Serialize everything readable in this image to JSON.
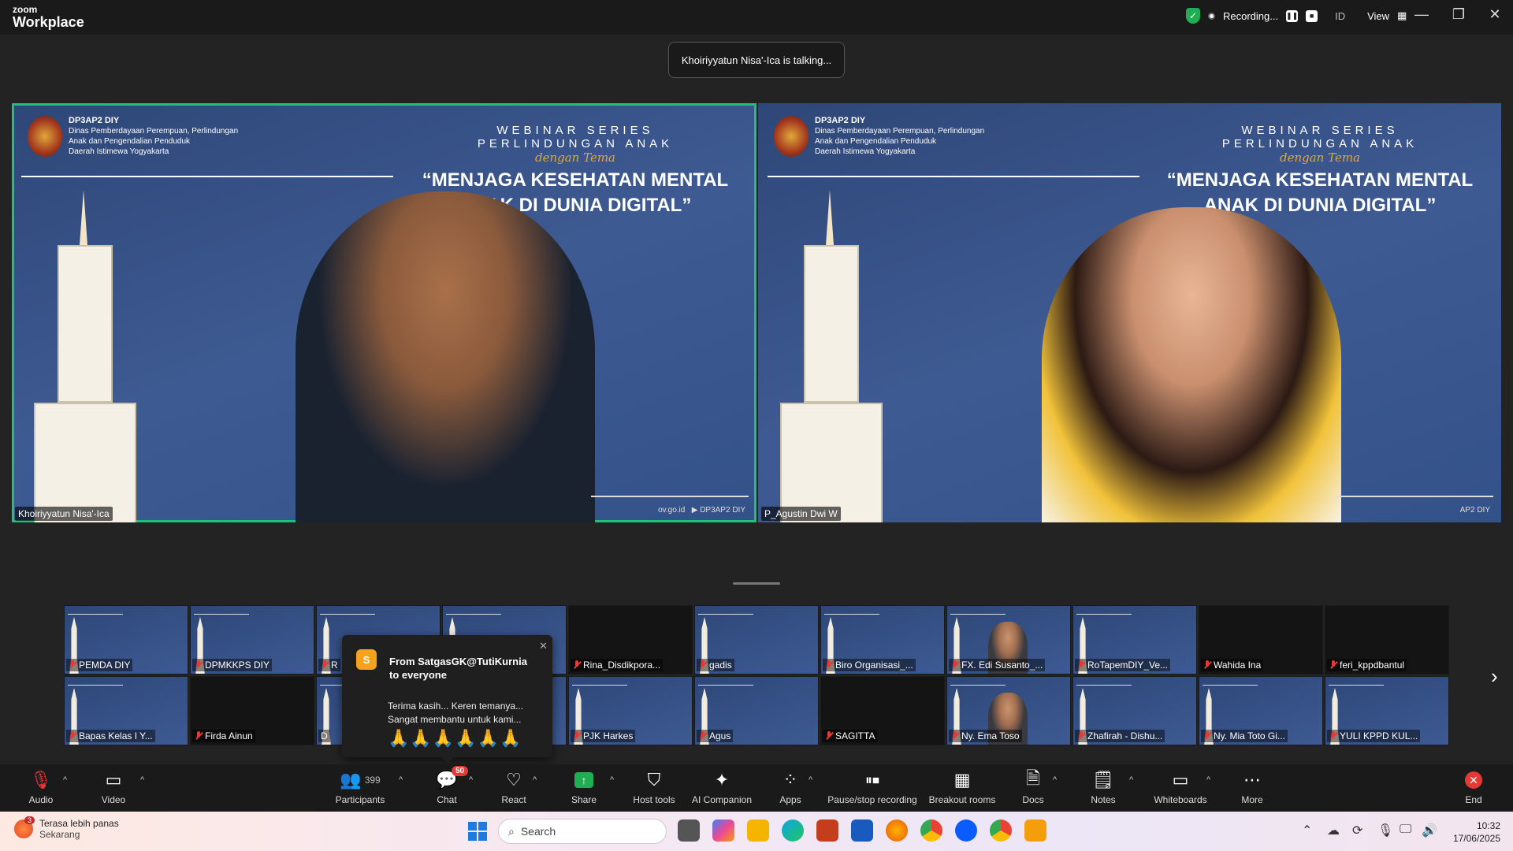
{
  "titlebar": {
    "logo_top": "zoom",
    "logo_bottom": "Workplace",
    "recording_label": "Recording...",
    "id_label": "ID",
    "view_label": "View"
  },
  "talking_toast": "Khoiriyyatun Nisa'-Ica is talking...",
  "slide": {
    "org_name": "DP3AP2 DIY",
    "org_line1": "Dinas Pemberdayaan Perempuan, Perlindungan",
    "org_line2": "Anak dan Pengendalian Penduduk",
    "org_line3": "Daerah Istimewa Yogyakarta",
    "series_line1": "WEBINAR SERIES",
    "series_line2": "PERLINDUNGAN ANAK",
    "dengan_tema": "dengan Tema",
    "title_line1": "“MENJAGA KESEHATAN MENTAL",
    "title_line2": "ANAK DI DUNIA DIGITAL”",
    "footer_web": "ov.go.id",
    "footer_yt": "DP3AP2 DIY",
    "footer_yt_cut": "AP2 DIY"
  },
  "main_videos": [
    {
      "name": "Khoiriyyatun Nisa'-Ica",
      "active": true
    },
    {
      "name": "P_Agustin Dwi W",
      "active": false
    }
  ],
  "gallery": {
    "row1": [
      {
        "name": "PEMDA DIY",
        "muted": true,
        "dark": false
      },
      {
        "name": "DPMKKPS DIY",
        "muted": true,
        "dark": false
      },
      {
        "name": "R",
        "muted": true,
        "dark": false
      },
      {
        "name": "",
        "muted": false,
        "dark": false
      },
      {
        "name": "Rina_Disdikpora...",
        "muted": true,
        "dark": true
      },
      {
        "name": "gadis",
        "muted": true,
        "dark": false
      },
      {
        "name": "Biro Organisasi_...",
        "muted": true,
        "dark": false
      },
      {
        "name": "FX. Edi Susanto_...",
        "muted": true,
        "dark": false,
        "face": true
      },
      {
        "name": "RoTapemDIY_Ve...",
        "muted": true,
        "dark": false
      },
      {
        "name": "Wahida Ina",
        "muted": true,
        "dark": true
      },
      {
        "name": "feri_kppdbantul",
        "muted": true,
        "dark": true
      }
    ],
    "row2": [
      {
        "name": "Bapas Kelas I Y...",
        "muted": true,
        "dark": false
      },
      {
        "name": "Firda Ainun",
        "muted": true,
        "dark": true
      },
      {
        "name": "D",
        "muted": false,
        "dark": false
      },
      {
        "name": "",
        "muted": false,
        "dark": false
      },
      {
        "name": "PJK Harkes",
        "muted": true,
        "dark": false
      },
      {
        "name": "Agus",
        "muted": true,
        "dark": false
      },
      {
        "name": "SAGITTA",
        "muted": true,
        "dark": true
      },
      {
        "name": "Ny. Ema Toso",
        "muted": true,
        "dark": false,
        "face": true
      },
      {
        "name": "Zhafirah - Dishu...",
        "muted": true,
        "dark": false
      },
      {
        "name": "Ny. Mia Toto Gi...",
        "muted": true,
        "dark": false
      },
      {
        "name": "YULI KPPD KUL...",
        "muted": true,
        "dark": false
      }
    ]
  },
  "chat_popup": {
    "avatar_letter": "S",
    "from": "From SatgasGK@TutiKurnia to everyone",
    "line1": "Terima kasih... Keren temanya...",
    "line2": "Sangat membantu untuk kami...",
    "emoji": "🙏🙏🙏🙏🙏🙏"
  },
  "toolbar": {
    "audio": "Audio",
    "video": "Video",
    "participants": "Participants",
    "participants_count": "399",
    "chat": "Chat",
    "chat_badge": "50",
    "react": "React",
    "share": "Share",
    "host_tools": "Host tools",
    "ai_companion": "AI Companion",
    "apps": "Apps",
    "pause_recording": "Pause/stop recording",
    "breakout": "Breakout rooms",
    "docs": "Docs",
    "notes": "Notes",
    "whiteboards": "Whiteboards",
    "more": "More",
    "end": "End"
  },
  "taskbar": {
    "weather_badge": "3",
    "weather_line1": "Terasa lebih panas",
    "weather_line2": "Sekarang",
    "search_placeholder": "Search",
    "time": "10:32",
    "date": "17/06/2025"
  },
  "colors": {
    "active_speaker": "#21c07a",
    "muted": "#e53935",
    "chat_avatar": "#f7a21b"
  }
}
